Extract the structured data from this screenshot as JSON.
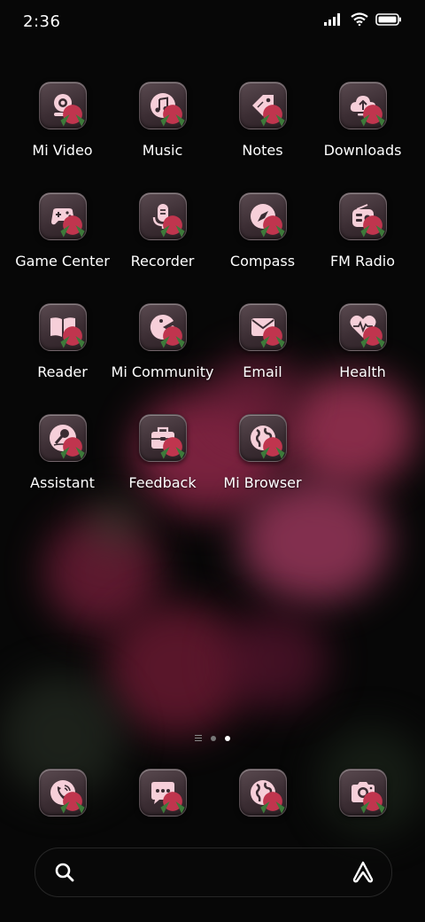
{
  "status_bar": {
    "time": "2:36"
  },
  "apps": [
    {
      "label": "Mi Video",
      "icon": "video-camera-icon"
    },
    {
      "label": "Music",
      "icon": "music-note-icon"
    },
    {
      "label": "Notes",
      "icon": "tag-icon"
    },
    {
      "label": "Downloads",
      "icon": "cloud-download-icon"
    },
    {
      "label": "Game Center",
      "icon": "gamepad-icon"
    },
    {
      "label": "Recorder",
      "icon": "microphone-icon"
    },
    {
      "label": "Compass",
      "icon": "compass-icon"
    },
    {
      "label": "FM Radio",
      "icon": "radio-icon"
    },
    {
      "label": "Reader",
      "icon": "book-icon"
    },
    {
      "label": "Mi Community",
      "icon": "pacman-icon"
    },
    {
      "label": "Email",
      "icon": "envelope-icon"
    },
    {
      "label": "Health",
      "icon": "heart-pulse-icon"
    },
    {
      "label": "Assistant",
      "icon": "assistant-icon"
    },
    {
      "label": "Feedback",
      "icon": "toolbox-icon"
    },
    {
      "label": "Mi Browser",
      "icon": "globe-icon"
    }
  ],
  "page_indicator": {
    "pages": 2,
    "active": 2
  },
  "dock": [
    {
      "icon": "phone-icon"
    },
    {
      "icon": "chat-icon"
    },
    {
      "icon": "globe-icon"
    },
    {
      "icon": "camera-icon"
    }
  ],
  "colors": {
    "icon_glyph": "#f6cfd9",
    "tile": "#3a2c32",
    "accent_rose": "#c0354e"
  }
}
